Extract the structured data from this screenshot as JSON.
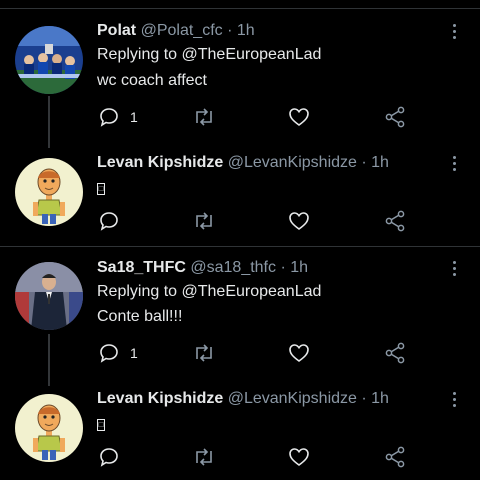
{
  "tweets": [
    {
      "name": "Polat",
      "handle": "@Polat_cfc",
      "time": "1h",
      "replying_prefix": "Replying to",
      "replying_to": "@TheEuropeanLad",
      "text": "wc coach affect",
      "reply_count": "1",
      "avatar": "team-crowd-photo"
    },
    {
      "name": "Levan Kipshidze",
      "handle": "@LevanKipshidze",
      "time": "1h",
      "text": "□",
      "reply_count": "",
      "avatar": "cartoon-character"
    },
    {
      "name": "Sa18_THFC",
      "handle": "@sa18_thfc",
      "time": "1h",
      "replying_prefix": "Replying to",
      "replying_to": "@TheEuropeanLad",
      "text": "Conte ball!!!",
      "reply_count": "1",
      "avatar": "coach-photo"
    },
    {
      "name": "Levan Kipshidze",
      "handle": "@LevanKipshidze",
      "time": "1h",
      "text": "□",
      "reply_count": "",
      "avatar": "cartoon-character"
    }
  ],
  "separator_dot": "·",
  "icons": {
    "reply": "reply-icon",
    "retweet": "retweet-icon",
    "like": "heart-icon",
    "share": "share-icon",
    "more": "more-icon"
  },
  "colors": {
    "background": "#000000",
    "text": "#e7e9ea",
    "muted": "#8b98a5",
    "border": "#2f3336"
  }
}
